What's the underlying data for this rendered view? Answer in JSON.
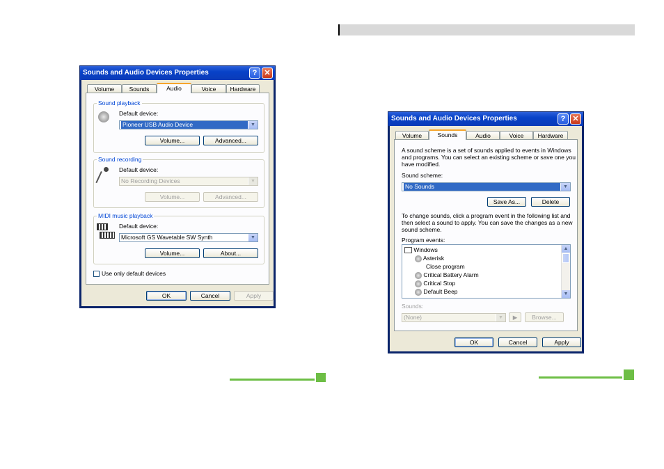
{
  "left_dialog": {
    "title": "Sounds and Audio Devices Properties",
    "tabs": [
      "Volume",
      "Sounds",
      "Audio",
      "Voice",
      "Hardware"
    ],
    "active_tab": "Audio",
    "playback": {
      "group": "Sound playback",
      "default_label": "Default device:",
      "device": "Pioneer USB Audio Device",
      "volume_btn": "Volume...",
      "advanced_btn": "Advanced..."
    },
    "recording": {
      "group": "Sound recording",
      "default_label": "Default device:",
      "device": "No Recording Devices",
      "volume_btn": "Volume...",
      "advanced_btn": "Advanced..."
    },
    "midi": {
      "group": "MIDI music playback",
      "default_label": "Default device:",
      "device": "Microsoft GS Wavetable SW Synth",
      "volume_btn": "Volume...",
      "about_btn": "About..."
    },
    "use_only_default": "Use only default devices",
    "ok": "OK",
    "cancel": "Cancel",
    "apply": "Apply"
  },
  "right_dialog": {
    "title": "Sounds and Audio Devices Properties",
    "tabs": [
      "Volume",
      "Sounds",
      "Audio",
      "Voice",
      "Hardware"
    ],
    "active_tab": "Sounds",
    "desc1": "A sound scheme is a set of sounds applied to events in Windows",
    "desc2": "and programs. You can select an existing scheme or save one you",
    "desc3": "have modified.",
    "scheme_label": "Sound scheme:",
    "scheme_value": "No Sounds",
    "save_as_btn": "Save As...",
    "delete_btn": "Delete",
    "change1": "To change sounds, click a program event in the following list and",
    "change2": "then select a sound to apply. You can save the changes as a new",
    "change3": "sound scheme.",
    "events_label": "Program events:",
    "events": [
      "Windows",
      "Asterisk",
      "Close program",
      "Critical Battery Alarm",
      "Critical Stop",
      "Default Beep"
    ],
    "sounds_label": "Sounds:",
    "sounds_value": "(None)",
    "play_icon": "play-icon",
    "browse_btn": "Browse...",
    "ok": "OK",
    "cancel": "Cancel",
    "apply": "Apply"
  },
  "colors": {
    "accent_green": "#6dbe45",
    "header_bar": "#d9d9d9",
    "title_blue": "#0842c8"
  }
}
